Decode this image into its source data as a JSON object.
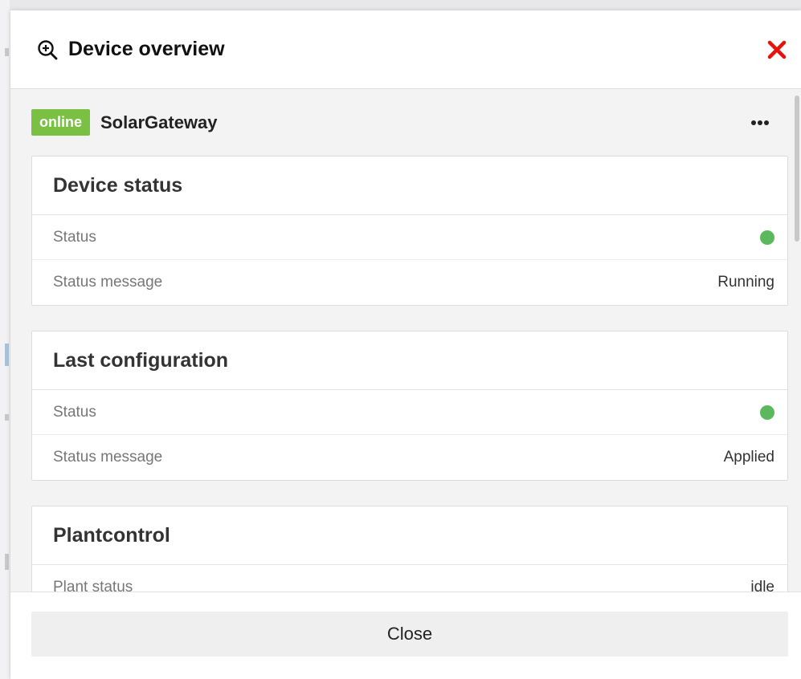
{
  "modal": {
    "title": "Device overview",
    "title_icon": "zoom-in-icon",
    "close_icon": "close-icon"
  },
  "device": {
    "badge": "online",
    "name": "SolarGateway",
    "menu_icon": "more-icon"
  },
  "cards": [
    {
      "title": "Device status",
      "rows": [
        {
          "label": "Status",
          "indicator": "green"
        },
        {
          "label": "Status message",
          "value": "Running"
        }
      ]
    },
    {
      "title": "Last configuration",
      "rows": [
        {
          "label": "Status",
          "indicator": "green"
        },
        {
          "label": "Status message",
          "value": "Applied"
        }
      ]
    },
    {
      "title": "Plantcontrol",
      "rows": [
        {
          "label": "Plant status",
          "value": "idle"
        }
      ]
    }
  ],
  "footer": {
    "close_label": "Close"
  },
  "colors": {
    "online_badge": "#7ac143",
    "status_ok": "#5cb85c",
    "close_icon": "#e8120c"
  }
}
